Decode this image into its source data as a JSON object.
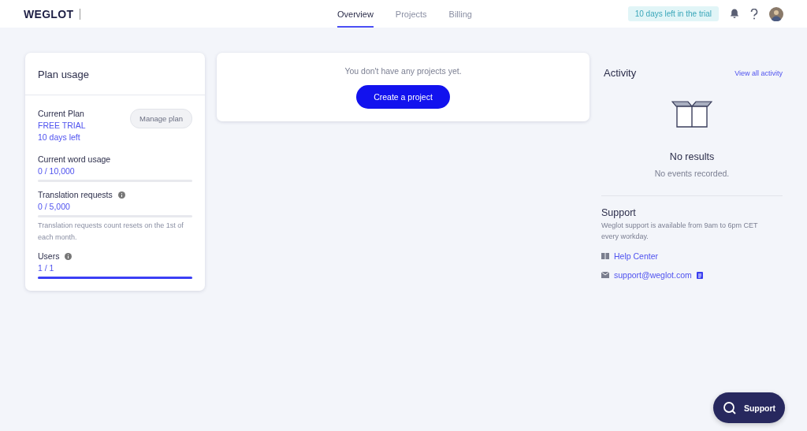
{
  "header": {
    "logo": "WEGLOT",
    "tabs": [
      {
        "label": "Overview",
        "selected": true
      },
      {
        "label": "Projects",
        "selected": false
      },
      {
        "label": "Billing",
        "selected": false
      }
    ],
    "trial_badge": "10 days left in the trial"
  },
  "plan_usage": {
    "title": "Plan usage",
    "plan_label": "Current Plan",
    "plan_name": "FREE TRIAL",
    "days_left": "10 days left",
    "manage_button": "Manage plan",
    "meters": [
      {
        "label": "Current word usage",
        "info": false,
        "reading": "0 / 10,000",
        "level": 0
      },
      {
        "label": "Translation requests",
        "info": true,
        "reading": "0 / 5,000",
        "level": 0,
        "note": "Translation requests count resets on the 1st of each month."
      },
      {
        "label": "Users",
        "info": true,
        "reading": "1 / 1",
        "level": 1
      }
    ]
  },
  "projects": {
    "empty_text": "You don't have any projects yet.",
    "create_button": "Create a project"
  },
  "activity": {
    "title": "Activity",
    "view_all": "View all activity",
    "empty_title": "No results",
    "empty_text": "No events recorded."
  },
  "support": {
    "title": "Support",
    "text": "Weglot support is available from 9am to 6pm CET every workday.",
    "links": [
      {
        "kind": "book",
        "label": "Help Center"
      },
      {
        "kind": "mail",
        "label": "support@weglot.com"
      }
    ]
  },
  "support_button": "Support"
}
